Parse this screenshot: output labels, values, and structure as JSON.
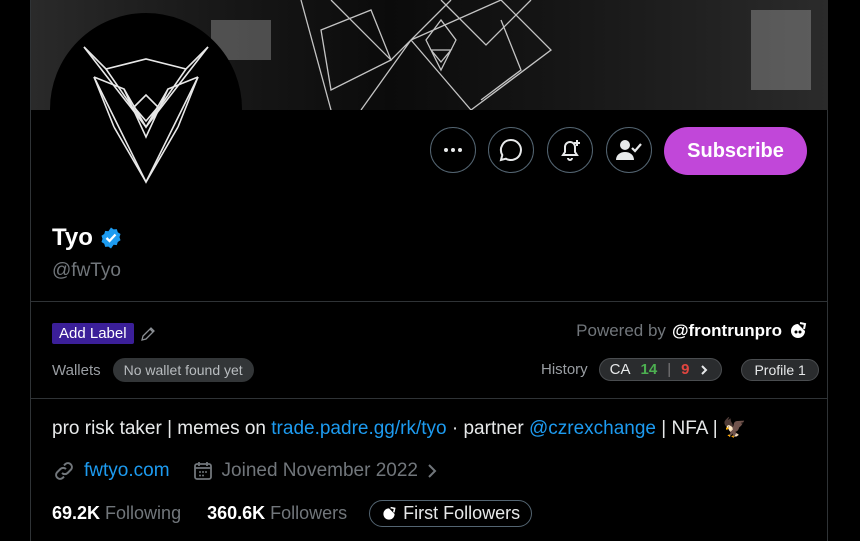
{
  "profile": {
    "name": "Tyo",
    "handle": "@fwTyo",
    "subscribe_label": "Subscribe"
  },
  "labels": {
    "add_label": "Add Label",
    "powered_by": "Powered by",
    "powered_brand": "@frontrunpro",
    "wallets": "Wallets",
    "no_wallet": "No wallet found yet",
    "history": "History",
    "ca": "CA",
    "ca_green": "14",
    "ca_sep": "|",
    "ca_red": "9",
    "profile_pill": "Profile 1"
  },
  "bio": {
    "part1": "pro risk taker | memes on ",
    "link1": "trade.padre.gg/rk/tyo",
    "part2": " · partner ",
    "link2": "@czrexchange",
    "part3": " | NFA | 🦅"
  },
  "meta": {
    "website": "fwtyo.com",
    "joined": "Joined November 2022"
  },
  "stats": {
    "following_num": "69.2K",
    "following_label": "Following",
    "followers_num": "360.6K",
    "followers_label": "Followers",
    "first_followers": "First Followers"
  },
  "colors": {
    "accent": "#1d9bf0",
    "subscribe": "#c147d9",
    "label_bg": "#3b1f99",
    "green": "#4caf50",
    "red": "#e0453f"
  },
  "icons": [
    "more-icon",
    "message-icon",
    "notify-icon",
    "follow-icon",
    "verified-icon",
    "edit-icon",
    "frontrun-icon",
    "chevron-right-icon",
    "link-icon",
    "calendar-icon",
    "eagle-icon"
  ]
}
